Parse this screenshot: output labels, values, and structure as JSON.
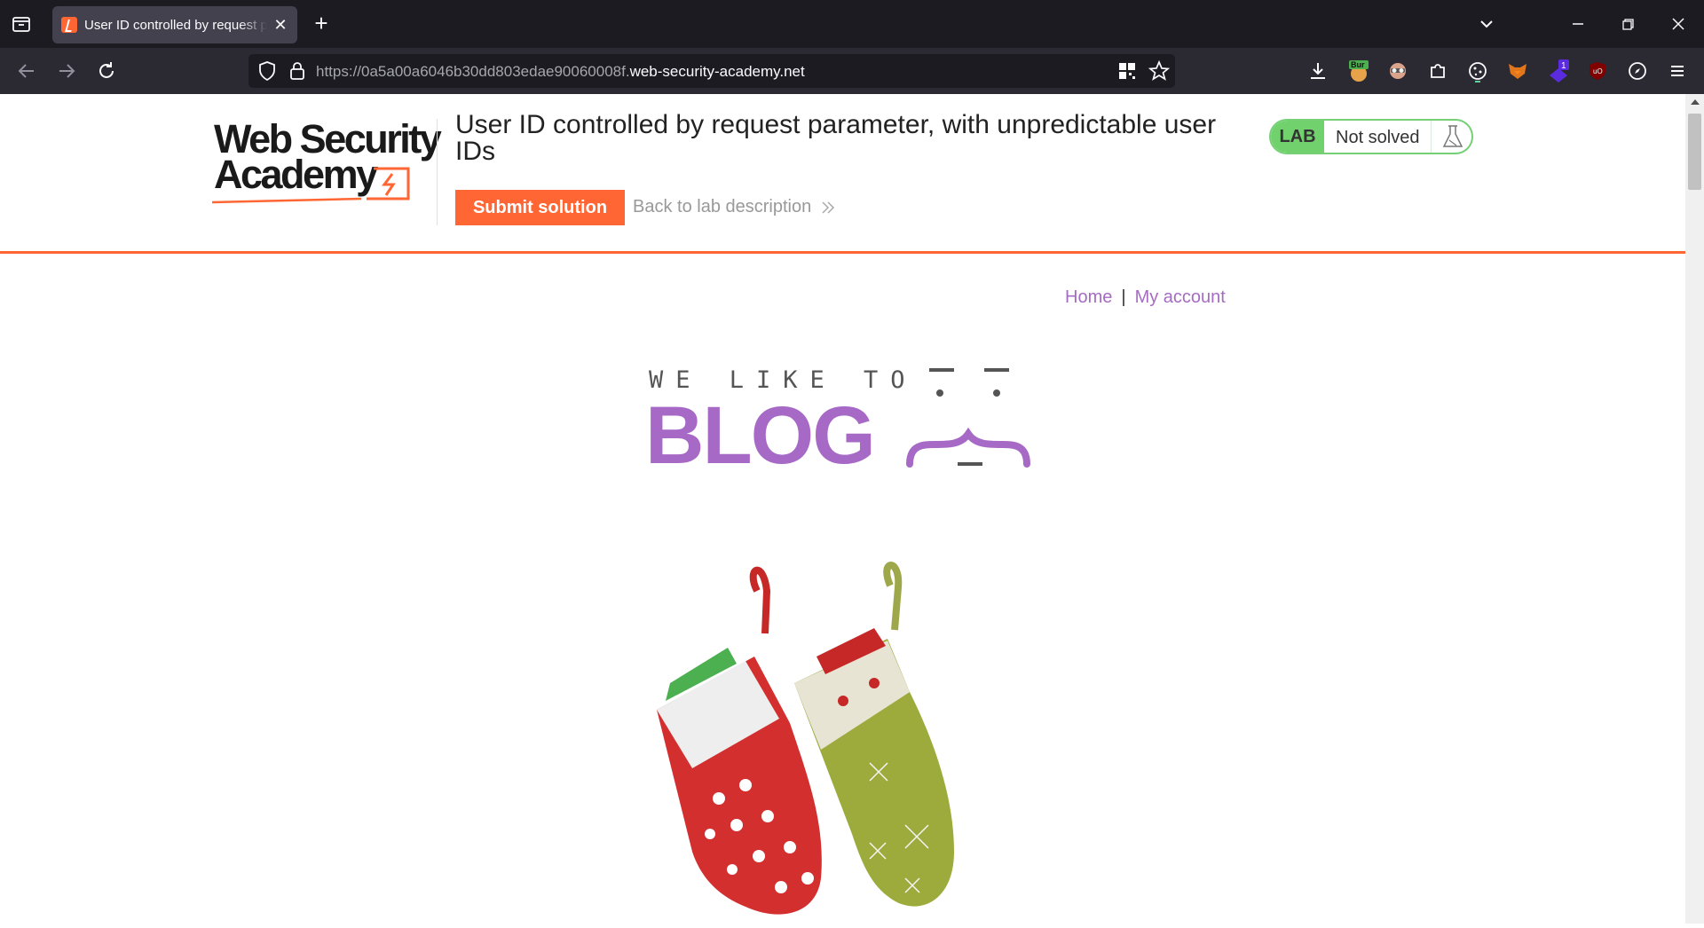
{
  "browser": {
    "tab_title": "User ID controlled by request parameter, with unpredictable user IDs",
    "url_prefix": "https://0a5a00a6046b30dd803edae90060008f.",
    "url_domain": "web-security-academy.net",
    "extensions": [
      "download-icon",
      "burp-extension-icon",
      "profile-extension-icon",
      "puzzle-extensions-icon",
      "cookie-icon",
      "fox-extension-icon",
      "purple-extension-icon",
      "ublock-icon",
      "compass-icon",
      "menu-icon"
    ],
    "burp_badge": "Bur",
    "purple_badge": "1"
  },
  "lab_header": {
    "logo_line1": "Web Security",
    "logo_line2": "Academy",
    "title": "User ID controlled by request parameter, with unpredictable user IDs",
    "submit_label": "Submit solution",
    "back_label": "Back to lab description",
    "badge": "LAB",
    "status": "Not solved"
  },
  "site_nav": {
    "home": "Home",
    "separator": "|",
    "account": "My account"
  },
  "banner": {
    "tagline": "WE LIKE TO",
    "title": "BLOG"
  },
  "colors": {
    "accent": "#ff6633",
    "blog_purple": "#a769c6",
    "lab_green": "#70d16d"
  }
}
